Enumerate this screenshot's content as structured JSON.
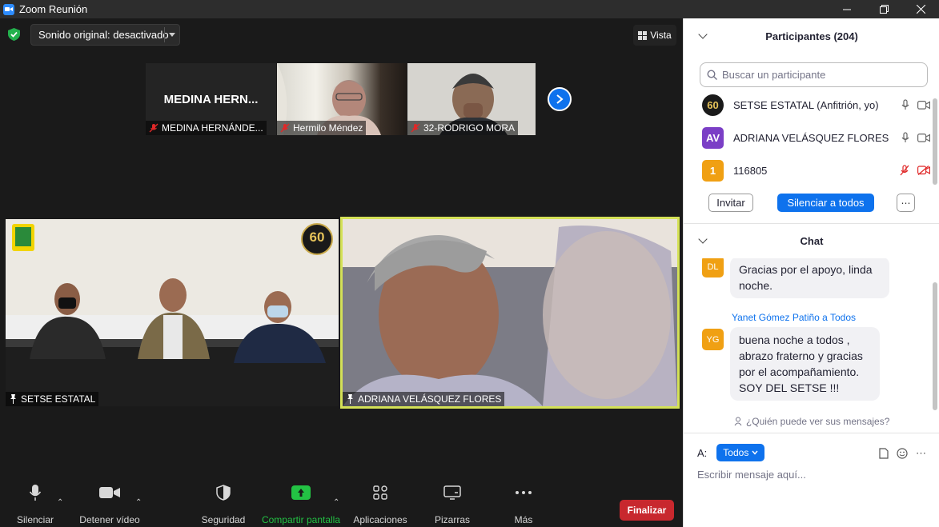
{
  "window": {
    "title": "Zoom Reunión"
  },
  "top": {
    "sound_label": "Sonido original: desactivado",
    "view_label": "Vista"
  },
  "strip": [
    {
      "name": "MEDINA HERNÁNDE...",
      "display": "MEDINA  HERN..."
    },
    {
      "name": "Hermilo Méndez"
    },
    {
      "name": "32-RODRIGO MORA"
    }
  ],
  "gallery": [
    {
      "name": "SETSE ESTATAL",
      "badge": "60"
    },
    {
      "name": "ADRIANA VELÁSQUEZ FLORES"
    }
  ],
  "toolbar": {
    "mute": "Silenciar",
    "video": "Detener vídeo",
    "security": "Seguridad",
    "share": "Compartir pantalla",
    "apps": "Aplicaciones",
    "whiteboards": "Pizarras",
    "more": "Más",
    "end": "Finalizar"
  },
  "participants": {
    "title": "Participantes (204)",
    "search_placeholder": "Buscar un participante",
    "list": [
      {
        "avatar": "60",
        "name": "SETSE ESTATAL (Anfitrión, yo)",
        "color": "#1a1a1a"
      },
      {
        "avatar": "AV",
        "name": "ADRIANA VELÁSQUEZ FLORES",
        "color": "#7b3fc6"
      },
      {
        "avatar": "1",
        "name": "116805",
        "color": "#f0a013"
      }
    ],
    "invite": "Invitar",
    "mute_all": "Silenciar a todos"
  },
  "chat": {
    "title": "Chat",
    "messages": [
      {
        "avatar": "DL",
        "sender": "",
        "text_lines": [
          "Gracias por el apoyo, linda",
          "noche."
        ]
      },
      {
        "avatar": "YG",
        "sender": "Yanet Gómez Patiño a Todos",
        "text_lines": [
          "buena noche a todos ,",
          "abrazo fraterno y gracias",
          "por el acompañamiento.",
          "SOY DEL SETSE !!!"
        ]
      }
    ],
    "who_can_see": "¿Quién puede ver sus mensajes?",
    "to_label": "A:",
    "to_value": "Todos",
    "input_placeholder": "Escribir mensaje aquí..."
  }
}
